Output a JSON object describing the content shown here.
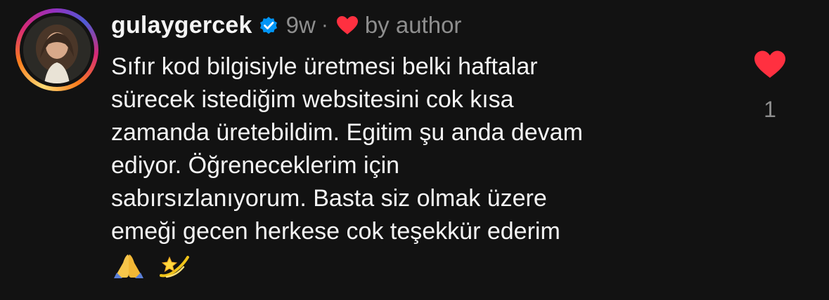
{
  "comment": {
    "username": "gulaygercek",
    "verified": true,
    "timestamp": "9w",
    "separator": "·",
    "liked_by": "by author",
    "text_lines": [
      "Sıfır kod bilgisiyle üretmesi belki haftalar",
      "sürecek istediğim websitesini cok kısa",
      "zamanda üretebildim. Egitim şu anda devam",
      "ediyor. Öğreneceklerim için",
      "sabırsızlanıyorum. Basta siz olmak üzere",
      "emeği gecen herkese cok teşekkür ederim"
    ],
    "emojis": [
      "folded-hands-emoji",
      "dizzy-emoji"
    ],
    "like_count": "1"
  },
  "colors": {
    "background": "#121212",
    "text_primary": "#f5f5f5",
    "text_secondary": "#8e8e8e",
    "heart_red": "#ff3040",
    "verified_blue": "#0095f6"
  },
  "icons": {
    "verified": "verified-badge-icon",
    "author_like": "heart-icon",
    "like_button": "heart-filled-icon"
  }
}
